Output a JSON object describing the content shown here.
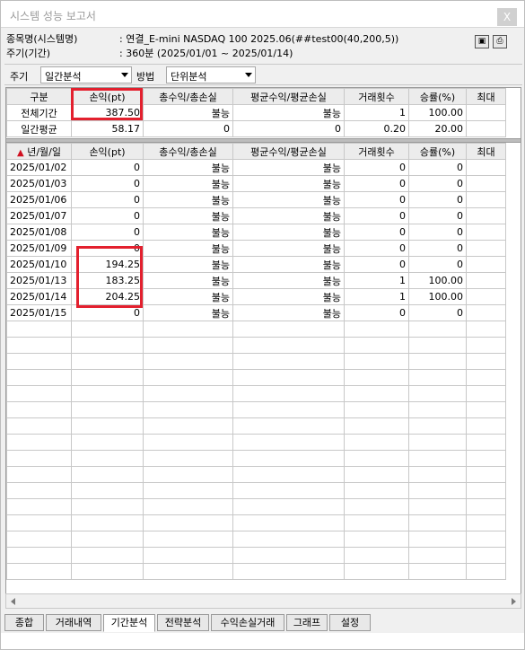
{
  "window": {
    "title": "시스템 성능 보고서",
    "close_label": "X"
  },
  "info": {
    "symbol_label": "종목명(시스템명)",
    "symbol_value": ": 연결_E-mini NASDAQ 100 2025.06(##test00(40,200,5))",
    "period_label": "주기(기간)",
    "period_value": ": 360분 (2025/01/01 ~ 2025/01/14)",
    "save_icon": "save-icon",
    "print_icon": "print-icon"
  },
  "filter": {
    "period_label": "주기",
    "period_value": "일간분석",
    "method_label": "방법",
    "method_value": "단위분석"
  },
  "summary": {
    "headers": [
      "구분",
      "손익(pt)",
      "총수익/총손실",
      "평균수익/평균손실",
      "거래횟수",
      "승률(%)",
      "최대"
    ],
    "rows": [
      [
        "전체기간",
        "387.50",
        "불능",
        "불능",
        "1",
        "100.00",
        ""
      ],
      [
        "일간평균",
        "58.17",
        "0",
        "0",
        "0.20",
        "20.00",
        ""
      ]
    ]
  },
  "daily": {
    "sort_icon": "up-arrow-icon",
    "headers": [
      "년/월/일",
      "손익(pt)",
      "총수익/총손실",
      "평균수익/평균손실",
      "거래횟수",
      "승률(%)",
      "최대"
    ],
    "rows": [
      [
        "2025/01/02",
        "0",
        "불능",
        "불능",
        "0",
        "0",
        ""
      ],
      [
        "2025/01/03",
        "0",
        "불능",
        "불능",
        "0",
        "0",
        ""
      ],
      [
        "2025/01/06",
        "0",
        "불능",
        "불능",
        "0",
        "0",
        ""
      ],
      [
        "2025/01/07",
        "0",
        "불능",
        "불능",
        "0",
        "0",
        ""
      ],
      [
        "2025/01/08",
        "0",
        "불능",
        "불능",
        "0",
        "0",
        ""
      ],
      [
        "2025/01/09",
        "0",
        "불능",
        "불능",
        "0",
        "0",
        ""
      ],
      [
        "2025/01/10",
        "194.25",
        "불능",
        "불능",
        "0",
        "0",
        ""
      ],
      [
        "2025/01/13",
        "183.25",
        "불능",
        "불능",
        "1",
        "100.00",
        ""
      ],
      [
        "2025/01/14",
        "204.25",
        "불능",
        "불능",
        "1",
        "100.00",
        ""
      ],
      [
        "2025/01/15",
        "0",
        "불능",
        "불능",
        "0",
        "0",
        ""
      ]
    ]
  },
  "tabs": [
    "종합",
    "거래내역",
    "기간분석",
    "전략분석",
    "수익손실거래",
    "그래프",
    "설정"
  ],
  "active_tab": "기간분석",
  "colors": {
    "highlight": "#e3202e",
    "sort_arrow": "#d01020"
  }
}
